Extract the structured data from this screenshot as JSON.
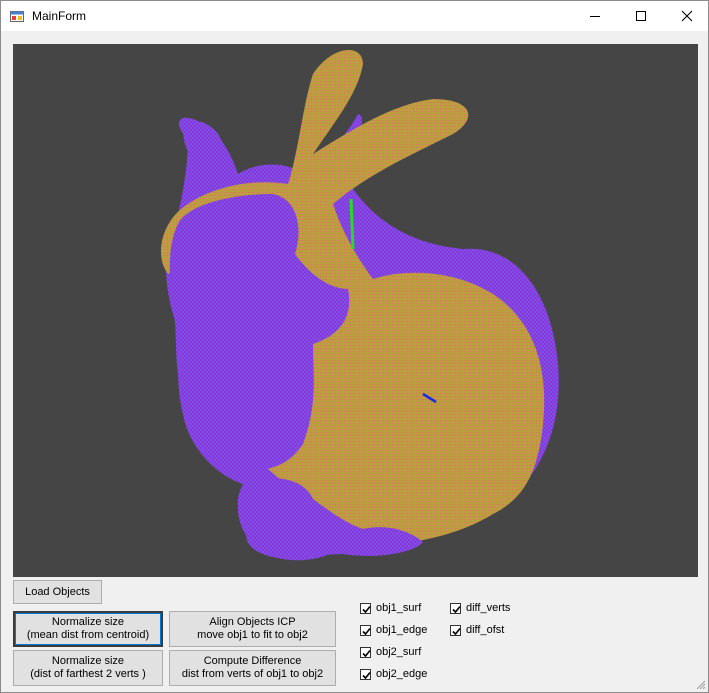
{
  "window": {
    "title": "MainForm"
  },
  "buttons": {
    "load_objects": "Load Objects",
    "normalize_mean_line1": "Normalize size",
    "normalize_mean_line2": "(mean dist from centroid)",
    "normalize_far_line1": "Normalize size",
    "normalize_far_line2": "(dist of farthest 2 verts )",
    "align_icp_line1": "Align Objects ICP",
    "align_icp_line2": "move obj1 to fit to obj2",
    "compute_diff_line1": "Compute Difference",
    "compute_diff_line2": "dist from verts of obj1 to obj2"
  },
  "checkboxes": [
    {
      "label": "obj1_surf",
      "checked": true
    },
    {
      "label": "obj1_edge",
      "checked": true
    },
    {
      "label": "obj2_surf",
      "checked": true
    },
    {
      "label": "obj2_edge",
      "checked": true
    },
    {
      "label": "diff_verts",
      "checked": true
    },
    {
      "label": "diff_ofst",
      "checked": true
    }
  ],
  "colors": {
    "viewport_bg": "#454545",
    "obj1_surface": "#6d5ee8",
    "obj1_edge": "#a21fd6",
    "obj2_surface": "#b7a33a",
    "obj2_edge": "#e56d6d",
    "axis_y": "#22dd22",
    "axis_z": "#1a2be8"
  }
}
